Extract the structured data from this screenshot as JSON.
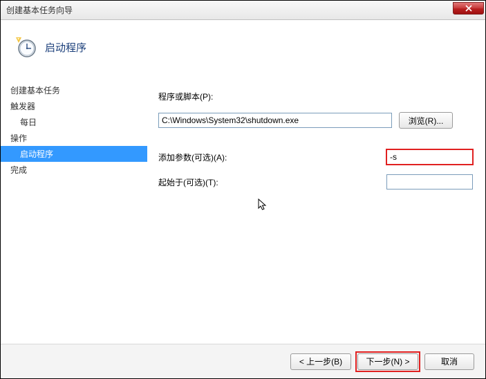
{
  "window": {
    "title": "创建基本任务向导"
  },
  "header": {
    "title": "启动程序"
  },
  "sidebar": {
    "items": [
      {
        "label": "创建基本任务",
        "indent": false
      },
      {
        "label": "触发器",
        "indent": false
      },
      {
        "label": "每日",
        "indent": true
      },
      {
        "label": "操作",
        "indent": false
      },
      {
        "label": "启动程序",
        "indent": true,
        "selected": true
      },
      {
        "label": "完成",
        "indent": false
      }
    ]
  },
  "form": {
    "program_label": "程序或脚本(P):",
    "program_value": "C:\\Windows\\System32\\shutdown.exe",
    "browse_label": "浏览(R)...",
    "args_label": "添加参数(可选)(A):",
    "args_value": "-s",
    "startin_label": "起始于(可选)(T):",
    "startin_value": ""
  },
  "footer": {
    "back": "< 上一步(B)",
    "next": "下一步(N) >",
    "cancel": "取消"
  }
}
